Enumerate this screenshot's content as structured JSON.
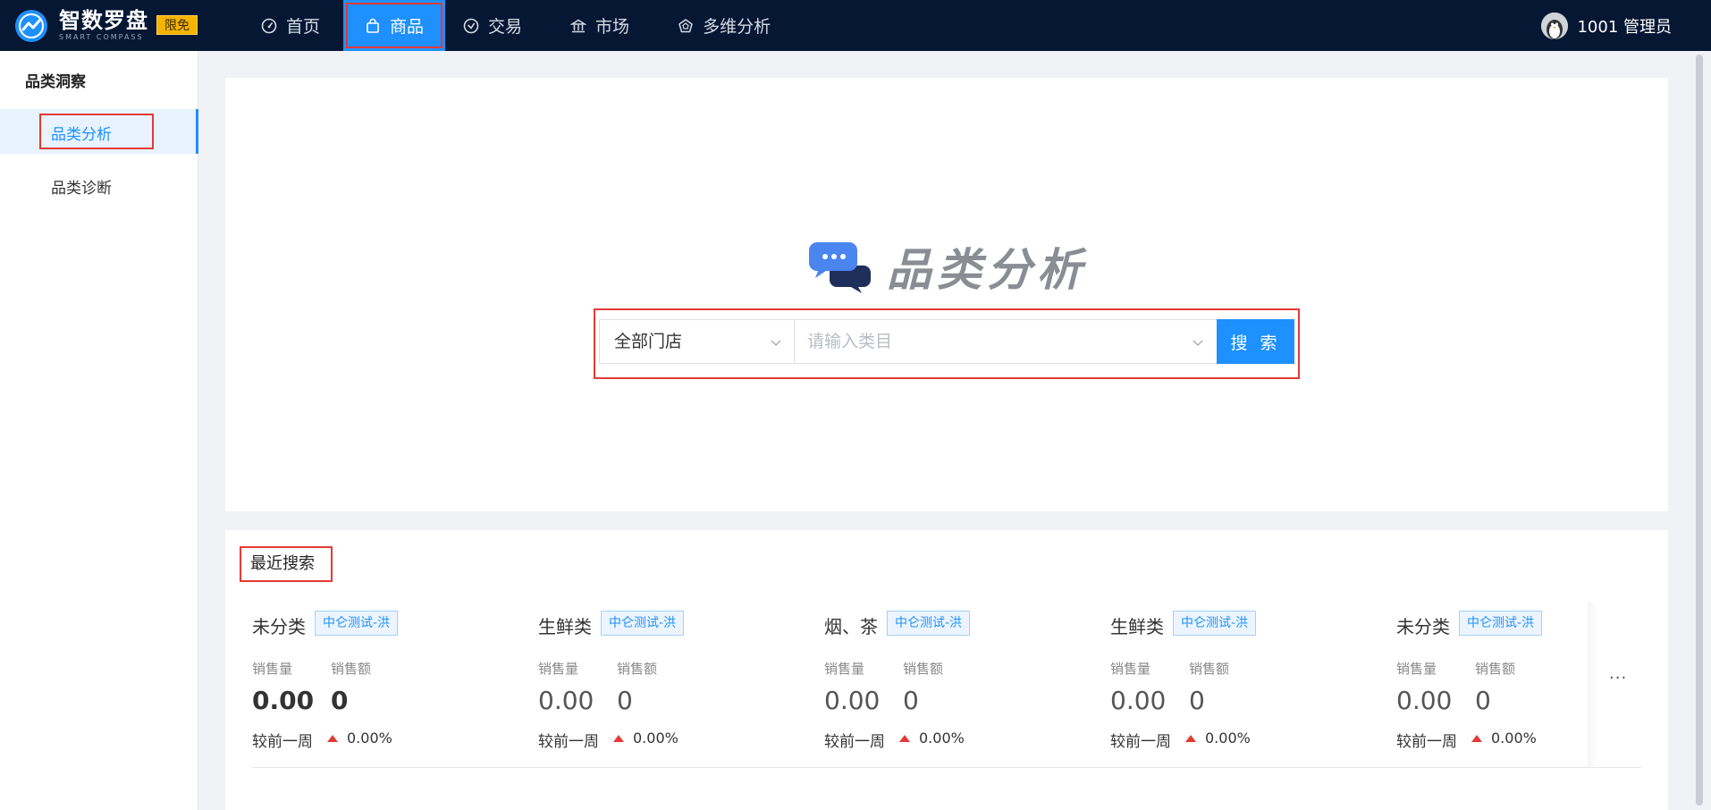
{
  "header": {
    "brand_name": "智数罗盘",
    "brand_sub": "SMART COMPASS",
    "badge": "限免",
    "nav": [
      {
        "label": "首页",
        "icon": "dashboard-icon"
      },
      {
        "label": "商品",
        "icon": "shopping-bag-icon",
        "active": true
      },
      {
        "label": "交易",
        "icon": "exchange-icon"
      },
      {
        "label": "市场",
        "icon": "bank-icon"
      },
      {
        "label": "多维分析",
        "icon": "pentagon-icon"
      }
    ],
    "user": "1001 管理员"
  },
  "sidebar": {
    "title": "品类洞察",
    "items": [
      {
        "label": "品类分析",
        "active": true
      },
      {
        "label": "品类诊断"
      }
    ]
  },
  "search": {
    "title": "品类分析",
    "store_select": "全部门店",
    "category_placeholder": "请输入类目",
    "button": "搜 索"
  },
  "recent": {
    "title": "最近搜索",
    "label_qty": "销售量",
    "label_amount": "销售额",
    "compare_label": "较前一周",
    "items": [
      {
        "name": "未分类",
        "tag": "中仑测试-洪",
        "qty": "0.00",
        "amount": "0",
        "change": "0.00%"
      },
      {
        "name": "生鲜类",
        "tag": "中仑测试-洪",
        "qty": "0.00",
        "amount": "0",
        "change": "0.00%"
      },
      {
        "name": "烟、茶",
        "tag": "中仑测试-洪",
        "qty": "0.00",
        "amount": "0",
        "change": "0.00%"
      },
      {
        "name": "生鲜类",
        "tag": "中仑测试-洪",
        "qty": "0.00",
        "amount": "0",
        "change": "0.00%"
      },
      {
        "name": "未分类",
        "tag": "中仑测试-洪",
        "qty": "0.00",
        "amount": "0",
        "change": "0.00%"
      }
    ],
    "more": "..."
  },
  "colors": {
    "topbar": "#061734",
    "accent": "#1e90ff",
    "highlight": "#e53935",
    "badge": "#f5b400"
  }
}
